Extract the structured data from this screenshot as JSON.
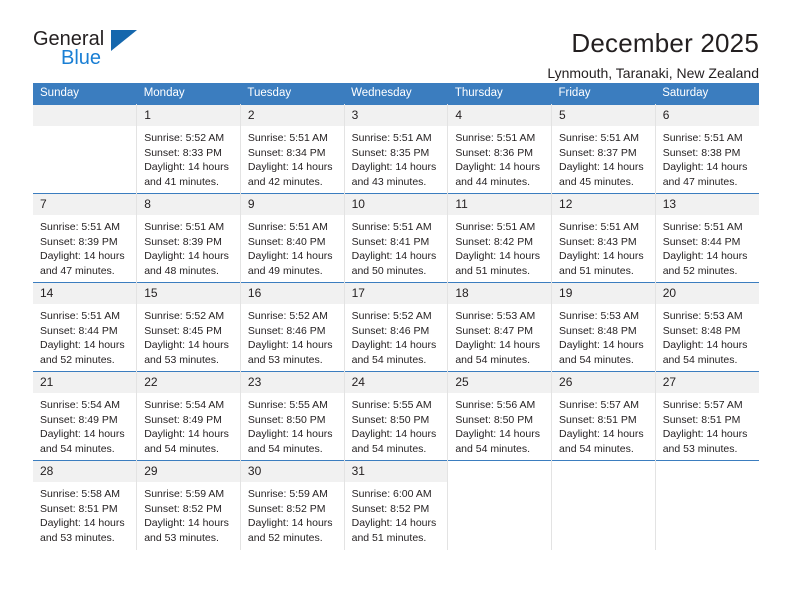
{
  "brand": {
    "name_part1": "General",
    "name_part2": "Blue",
    "triangle_icon": "triangle-icon"
  },
  "header": {
    "title": "December 2025",
    "subtitle": "Lynmouth, Taranaki, New Zealand"
  },
  "colors": {
    "header_blue": "#3b7dbf",
    "logo_blue": "#1a7fd4",
    "daynum_background": "#f1f1f1",
    "text": "#231f20"
  },
  "weekday_headers": [
    "Sunday",
    "Monday",
    "Tuesday",
    "Wednesday",
    "Thursday",
    "Friday",
    "Saturday"
  ],
  "weeks": [
    [
      {
        "day": "",
        "lines": []
      },
      {
        "day": "1",
        "lines": [
          "Sunrise: 5:52 AM",
          "Sunset: 8:33 PM",
          "Daylight: 14 hours",
          "and 41 minutes."
        ]
      },
      {
        "day": "2",
        "lines": [
          "Sunrise: 5:51 AM",
          "Sunset: 8:34 PM",
          "Daylight: 14 hours",
          "and 42 minutes."
        ]
      },
      {
        "day": "3",
        "lines": [
          "Sunrise: 5:51 AM",
          "Sunset: 8:35 PM",
          "Daylight: 14 hours",
          "and 43 minutes."
        ]
      },
      {
        "day": "4",
        "lines": [
          "Sunrise: 5:51 AM",
          "Sunset: 8:36 PM",
          "Daylight: 14 hours",
          "and 44 minutes."
        ]
      },
      {
        "day": "5",
        "lines": [
          "Sunrise: 5:51 AM",
          "Sunset: 8:37 PM",
          "Daylight: 14 hours",
          "and 45 minutes."
        ]
      },
      {
        "day": "6",
        "lines": [
          "Sunrise: 5:51 AM",
          "Sunset: 8:38 PM",
          "Daylight: 14 hours",
          "and 47 minutes."
        ]
      }
    ],
    [
      {
        "day": "7",
        "lines": [
          "Sunrise: 5:51 AM",
          "Sunset: 8:39 PM",
          "Daylight: 14 hours",
          "and 47 minutes."
        ]
      },
      {
        "day": "8",
        "lines": [
          "Sunrise: 5:51 AM",
          "Sunset: 8:39 PM",
          "Daylight: 14 hours",
          "and 48 minutes."
        ]
      },
      {
        "day": "9",
        "lines": [
          "Sunrise: 5:51 AM",
          "Sunset: 8:40 PM",
          "Daylight: 14 hours",
          "and 49 minutes."
        ]
      },
      {
        "day": "10",
        "lines": [
          "Sunrise: 5:51 AM",
          "Sunset: 8:41 PM",
          "Daylight: 14 hours",
          "and 50 minutes."
        ]
      },
      {
        "day": "11",
        "lines": [
          "Sunrise: 5:51 AM",
          "Sunset: 8:42 PM",
          "Daylight: 14 hours",
          "and 51 minutes."
        ]
      },
      {
        "day": "12",
        "lines": [
          "Sunrise: 5:51 AM",
          "Sunset: 8:43 PM",
          "Daylight: 14 hours",
          "and 51 minutes."
        ]
      },
      {
        "day": "13",
        "lines": [
          "Sunrise: 5:51 AM",
          "Sunset: 8:44 PM",
          "Daylight: 14 hours",
          "and 52 minutes."
        ]
      }
    ],
    [
      {
        "day": "14",
        "lines": [
          "Sunrise: 5:51 AM",
          "Sunset: 8:44 PM",
          "Daylight: 14 hours",
          "and 52 minutes."
        ]
      },
      {
        "day": "15",
        "lines": [
          "Sunrise: 5:52 AM",
          "Sunset: 8:45 PM",
          "Daylight: 14 hours",
          "and 53 minutes."
        ]
      },
      {
        "day": "16",
        "lines": [
          "Sunrise: 5:52 AM",
          "Sunset: 8:46 PM",
          "Daylight: 14 hours",
          "and 53 minutes."
        ]
      },
      {
        "day": "17",
        "lines": [
          "Sunrise: 5:52 AM",
          "Sunset: 8:46 PM",
          "Daylight: 14 hours",
          "and 54 minutes."
        ]
      },
      {
        "day": "18",
        "lines": [
          "Sunrise: 5:53 AM",
          "Sunset: 8:47 PM",
          "Daylight: 14 hours",
          "and 54 minutes."
        ]
      },
      {
        "day": "19",
        "lines": [
          "Sunrise: 5:53 AM",
          "Sunset: 8:48 PM",
          "Daylight: 14 hours",
          "and 54 minutes."
        ]
      },
      {
        "day": "20",
        "lines": [
          "Sunrise: 5:53 AM",
          "Sunset: 8:48 PM",
          "Daylight: 14 hours",
          "and 54 minutes."
        ]
      }
    ],
    [
      {
        "day": "21",
        "lines": [
          "Sunrise: 5:54 AM",
          "Sunset: 8:49 PM",
          "Daylight: 14 hours",
          "and 54 minutes."
        ]
      },
      {
        "day": "22",
        "lines": [
          "Sunrise: 5:54 AM",
          "Sunset: 8:49 PM",
          "Daylight: 14 hours",
          "and 54 minutes."
        ]
      },
      {
        "day": "23",
        "lines": [
          "Sunrise: 5:55 AM",
          "Sunset: 8:50 PM",
          "Daylight: 14 hours",
          "and 54 minutes."
        ]
      },
      {
        "day": "24",
        "lines": [
          "Sunrise: 5:55 AM",
          "Sunset: 8:50 PM",
          "Daylight: 14 hours",
          "and 54 minutes."
        ]
      },
      {
        "day": "25",
        "lines": [
          "Sunrise: 5:56 AM",
          "Sunset: 8:50 PM",
          "Daylight: 14 hours",
          "and 54 minutes."
        ]
      },
      {
        "day": "26",
        "lines": [
          "Sunrise: 5:57 AM",
          "Sunset: 8:51 PM",
          "Daylight: 14 hours",
          "and 54 minutes."
        ]
      },
      {
        "day": "27",
        "lines": [
          "Sunrise: 5:57 AM",
          "Sunset: 8:51 PM",
          "Daylight: 14 hours",
          "and 53 minutes."
        ]
      }
    ],
    [
      {
        "day": "28",
        "lines": [
          "Sunrise: 5:58 AM",
          "Sunset: 8:51 PM",
          "Daylight: 14 hours",
          "and 53 minutes."
        ]
      },
      {
        "day": "29",
        "lines": [
          "Sunrise: 5:59 AM",
          "Sunset: 8:52 PM",
          "Daylight: 14 hours",
          "and 53 minutes."
        ]
      },
      {
        "day": "30",
        "lines": [
          "Sunrise: 5:59 AM",
          "Sunset: 8:52 PM",
          "Daylight: 14 hours",
          "and 52 minutes."
        ]
      },
      {
        "day": "31",
        "lines": [
          "Sunrise: 6:00 AM",
          "Sunset: 8:52 PM",
          "Daylight: 14 hours",
          "and 51 minutes."
        ]
      },
      {
        "day": "",
        "lines": []
      },
      {
        "day": "",
        "lines": []
      },
      {
        "day": "",
        "lines": []
      }
    ]
  ]
}
